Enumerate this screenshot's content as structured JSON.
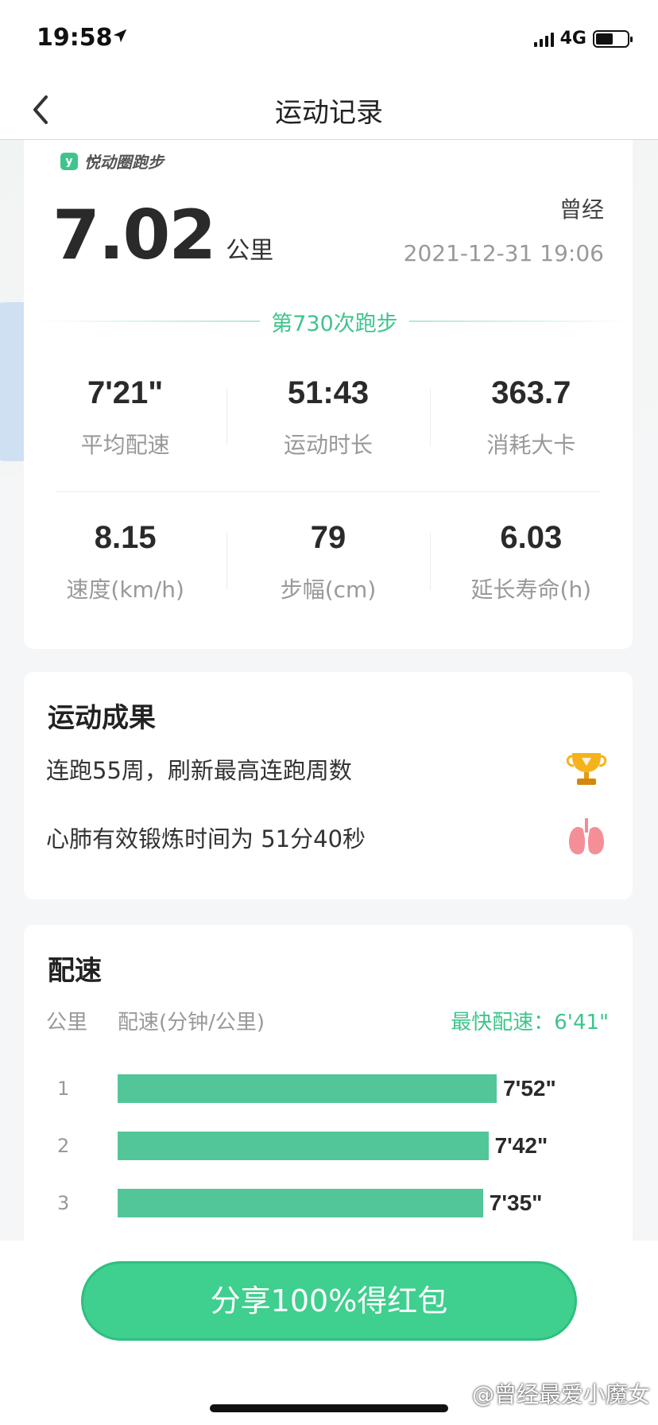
{
  "status_bar": {
    "time": "19:58",
    "network": "4G",
    "battery_level": 0.55
  },
  "nav": {
    "title": "运动记录",
    "back_icon": "chevron-left-icon"
  },
  "summary": {
    "brand": "悦动圈跑步",
    "distance": "7.02",
    "distance_unit": "公里",
    "user_name": "曾经",
    "date": "2021-12-31 19:06",
    "run_count_label": "第730次跑步",
    "stats": [
      {
        "value": "7'21\"",
        "label": "平均配速"
      },
      {
        "value": "51:43",
        "label": "运动时长"
      },
      {
        "value": "363.7",
        "label": "消耗大卡"
      },
      {
        "value": "8.15",
        "label": "速度(km/h)"
      },
      {
        "value": "79",
        "label": "步幅(cm)"
      },
      {
        "value": "6.03",
        "label": "延长寿命(h)"
      }
    ]
  },
  "results": {
    "title": "运动成果",
    "items": [
      {
        "text": "连跑55周，刷新最高连跑周数",
        "icon": "trophy-icon"
      },
      {
        "text": "心肺有效锻炼时间为 51分40秒",
        "icon": "lungs-icon"
      }
    ]
  },
  "pace": {
    "title": "配速",
    "col_km": "公里",
    "col_pace": "配速(分钟/公里)",
    "fastest_label": "最快配速：6'41\"",
    "rows": [
      {
        "km": "1",
        "pace": "7'52\"",
        "fill": 0.772
      },
      {
        "km": "2",
        "pace": "7'42\"",
        "fill": 0.755
      },
      {
        "km": "3",
        "pace": "7'35\"",
        "fill": 0.744
      }
    ]
  },
  "share_button": "分享100%得红包",
  "watermark": "@曾经最爱小魔女",
  "colors": {
    "accent": "#3fc48c",
    "bar": "#52c698",
    "button": "#3fcf8e"
  }
}
